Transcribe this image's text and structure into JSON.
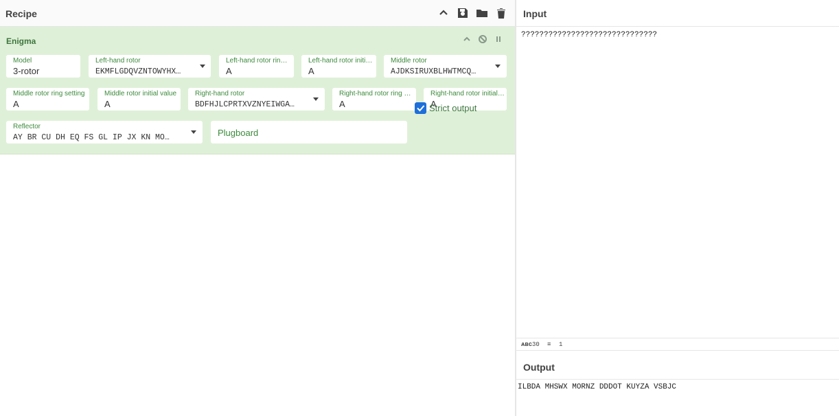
{
  "recipe": {
    "title": "Recipe"
  },
  "operation": {
    "name": "Enigma",
    "fields": {
      "model": {
        "label": "Model",
        "value": "3-rotor"
      },
      "left_rotor": {
        "label": "Left-hand rotor",
        "value": "EKMFLGDQVZNTOWYHX…"
      },
      "left_ring": {
        "label": "Left-hand rotor ring …",
        "value": "A"
      },
      "left_initial": {
        "label": "Left-hand rotor initi…",
        "value": "A"
      },
      "middle_rotor": {
        "label": "Middle rotor",
        "value": "AJDKSIRUXBLHWTMCQ…"
      },
      "middle_ring": {
        "label": "Middle rotor ring setting",
        "value": "A"
      },
      "middle_initial": {
        "label": "Middle rotor initial value",
        "value": "A"
      },
      "right_rotor": {
        "label": "Right-hand rotor",
        "value": "BDFHJLCPRTXVZNYEIWGA…"
      },
      "right_ring": {
        "label": "Right-hand rotor ring s…",
        "value": "A"
      },
      "right_initial": {
        "label": "Right-hand rotor initial …",
        "value": "A"
      },
      "reflector": {
        "label": "Reflector",
        "value": "AY BR CU DH EQ FS GL IP JX KN MO…"
      },
      "plugboard": {
        "placeholder": "Plugboard"
      },
      "strict_output": {
        "label": "Strict output",
        "checked": true
      }
    }
  },
  "input": {
    "title": "Input",
    "text": "??????????????????????????????",
    "status": {
      "char_count": "30",
      "line_count": "1"
    }
  },
  "output": {
    "title": "Output",
    "text": "ILBDA MHSWX MORNZ DDDOT KUYZA VSBJC"
  },
  "colors": {
    "accent_green": "#3c763d",
    "operation_bg": "#dff0d8",
    "checkbox": "#1e6fd9"
  }
}
